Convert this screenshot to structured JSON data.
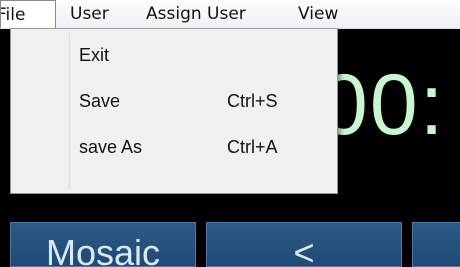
{
  "menubar": {
    "items": [
      {
        "label": "File"
      },
      {
        "label": "User"
      },
      {
        "label": "Assign User"
      },
      {
        "label": "View"
      }
    ]
  },
  "clock": {
    "display": "00:"
  },
  "file_menu": {
    "items": [
      {
        "label": "Exit",
        "shortcut": ""
      },
      {
        "label": "Save",
        "shortcut": "Ctrl+S"
      },
      {
        "label": "save As",
        "shortcut": "Ctrl+A"
      }
    ]
  },
  "toolbar": {
    "mosaic_label": "Mosaic",
    "prev_label": "<",
    "next_label": ""
  },
  "colors": {
    "background": "#000000",
    "clock_text": "#c9f5d0",
    "button_fill": "#24507c",
    "menu_fill": "#f0f0f0"
  }
}
